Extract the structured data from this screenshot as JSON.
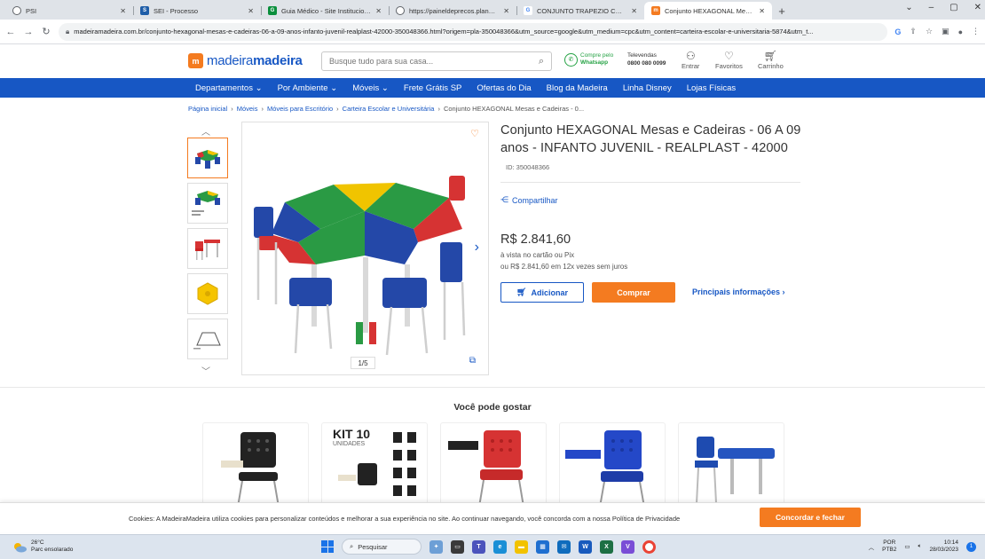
{
  "browser": {
    "tabs": [
      {
        "title": "PSI",
        "favicon_color": "#5f6368",
        "favicon_glyph": "globe-icon"
      },
      {
        "title": "SEI - Processo",
        "favicon_color": "#1f5ea8",
        "favicon_glyph": "sei-icon"
      },
      {
        "title": "Guia Médico - Site Institucional",
        "favicon_color": "#0b8f3d",
        "favicon_glyph": "guia-icon"
      },
      {
        "title": "https://paineldeprecos.planejam...",
        "favicon_color": "#5f6368",
        "favicon_glyph": "globe-icon"
      },
      {
        "title": "CONJUNTO TRAPEZIO COMPOSTO",
        "favicon_color": "#4285f4",
        "favicon_glyph": "google-icon"
      },
      {
        "title": "Conjunto HEXAGONAL Mesas e",
        "favicon_color": "#f47b20",
        "favicon_glyph": "madeira-icon"
      }
    ],
    "url": "madeiramadeira.com.br/conjunto-hexagonal-mesas-e-cadeiras-06-a-09-anos-infanto-juvenil-realplast-42000-350048366.html?origem=pla-350048366&utm_source=google&utm_medium=cpc&utm_content=carteira-escolar-e-universitaria-5874&utm_t..."
  },
  "header": {
    "logo_light": "madeira",
    "logo_bold": "madeira",
    "search_placeholder": "Busque tudo para sua casa...",
    "whatsapp_line1": "Compre pelo",
    "whatsapp_line2": "Whatsapp",
    "tel_line1": "Televendas",
    "tel_line2": "0800 080 0099",
    "login_label": "Entrar",
    "favorites_label": "Favoritos",
    "cart_label": "Carrinho"
  },
  "nav": {
    "items": [
      "Departamentos ⌄",
      "Por Ambiente ⌄",
      "Móveis ⌄",
      "Frete Grátis SP",
      "Ofertas do Dia",
      "Blog da Madeira",
      "Linha Disney",
      "Lojas Físicas"
    ]
  },
  "breadcrumb": {
    "items": [
      "Página inicial",
      "Móveis",
      "Móveis para Escritório",
      "Carteira Escolar e Universitária"
    ],
    "current": "Conjunto HEXAGONAL Mesas e Cadeiras - 0..."
  },
  "gallery": {
    "counter": "1/5"
  },
  "product": {
    "title": "Conjunto HEXAGONAL Mesas e Cadeiras - 06 A 09 anos - INFANTO JUVENIL - REALPLAST - 42000",
    "id_label": "ID: 350048366",
    "share_label": "Compartilhar",
    "price": "R$ 2.841,60",
    "payment_line1": "à vista no cartão ou Pix",
    "payment_line2": "ou R$ 2.841,60 em 12x vezes sem juros",
    "add_label": "Adicionar",
    "buy_label": "Comprar",
    "info_label": "Principais informações ›"
  },
  "recommendations": {
    "title": "Você pode gostar",
    "kit_label": "KIT 10",
    "kit_sub": "UNIDADES"
  },
  "cookie": {
    "text": "Cookies: A MadeiraMadeira utiliza cookies para personalizar conteúdos e melhorar a sua experiência no site. Ao continuar navegando, você concorda com a nossa Política de Privacidade",
    "button": "Concordar e fechar"
  },
  "taskbar": {
    "temp": "26°C",
    "weather": "Parc ensolarado",
    "search": "Pesquisar",
    "lang1": "POR",
    "lang2": "PTB2",
    "time": "10:14",
    "date": "28/03/2023",
    "notifications": "1"
  },
  "colors": {
    "brand_blue": "#1757c4",
    "brand_orange": "#f47b20"
  }
}
